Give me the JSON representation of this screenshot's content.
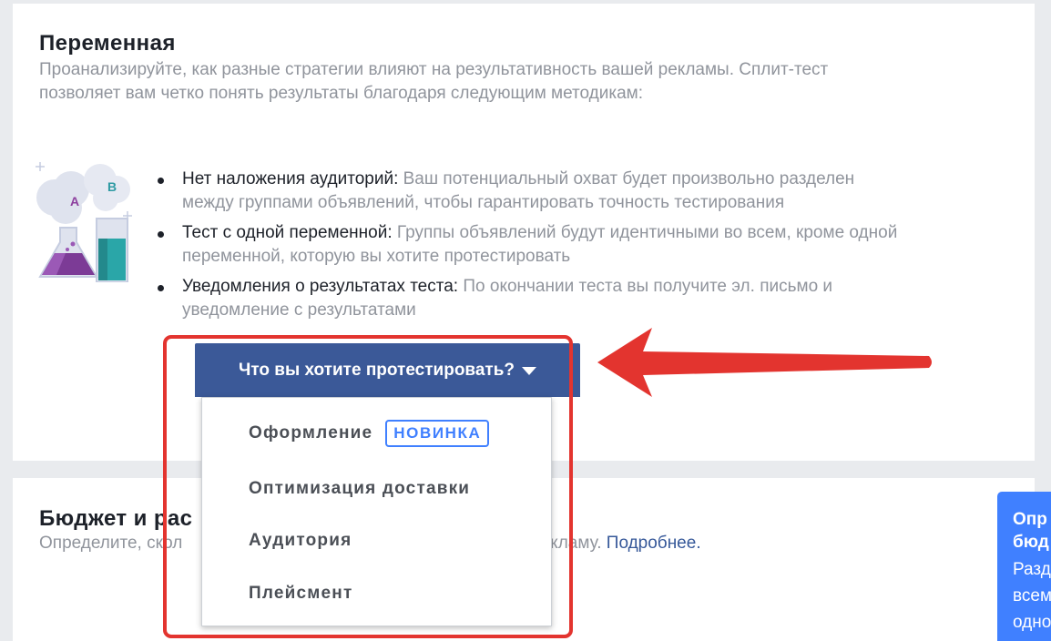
{
  "variable": {
    "title": "Переменная",
    "desc_line1": "Проанализируйте, как разные стратегии влияют на результативность вашей рекламы. Сплит-тест",
    "desc_line2": "позволяет вам четко понять результаты благодаря следующим методикам:",
    "bullets": [
      {
        "title": "Нет наложения аудиторий:",
        "line1": " Ваш потенциальный охват будет произвольно разделен",
        "line2": "между группами объявлений, чтобы гарантировать точность тестирования"
      },
      {
        "title": "Тест с одной переменной:",
        "line1": " Группы объявлений будут идентичными во всем, кроме одной",
        "line2": "переменной, которую вы хотите протестировать"
      },
      {
        "title": "Уведомления о результатах теста:",
        "line1": " По окончании теста вы получите эл. письмо и",
        "line2": "уведомление с результатами"
      }
    ],
    "illustration": {
      "label_a": "A",
      "label_b": "B"
    },
    "test_button_label": "Что вы хотите протестировать?"
  },
  "menu": {
    "items": [
      {
        "label": "Оформление",
        "badge": "НОВИНКА"
      },
      {
        "label": "Оптимизация доставки"
      },
      {
        "label": "Аудитория"
      },
      {
        "label": "Плейсмент"
      }
    ]
  },
  "budget": {
    "title_visible": "Бюджет и рас",
    "desc_start": "Определите, скол",
    "desc_end": "ите показывать свою рекламу. ",
    "more_link": "Подробнее."
  },
  "tooltip": {
    "title_line1": "Опр",
    "title_line2": "бюд",
    "body_lines": [
      "Разд",
      "всем",
      "одно"
    ]
  },
  "colors": {
    "button": "#3b5998",
    "highlight": "#e3342f",
    "badge": "#4080ff",
    "tooltip": "#4080ff",
    "link": "#365899"
  },
  "icons": {
    "dropdown": "caret-down-icon",
    "arrow": "red-arrow-left-icon"
  }
}
